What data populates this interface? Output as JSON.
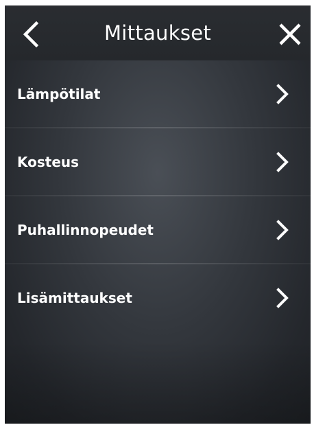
{
  "header": {
    "title": "Mittaukset",
    "back_icon": "chevron-left-icon",
    "close_icon": "close-icon"
  },
  "menu": {
    "items": [
      {
        "label": "Lämpötilat",
        "icon": "chevron-right-icon"
      },
      {
        "label": "Kosteus",
        "icon": "chevron-right-icon"
      },
      {
        "label": "Puhallinnopeudet",
        "icon": "chevron-right-icon"
      },
      {
        "label": "Lisämittaukset",
        "icon": "chevron-right-icon"
      }
    ]
  },
  "colors": {
    "text": "#ffffff",
    "background": "#33373d",
    "header": "#2a2d31"
  }
}
